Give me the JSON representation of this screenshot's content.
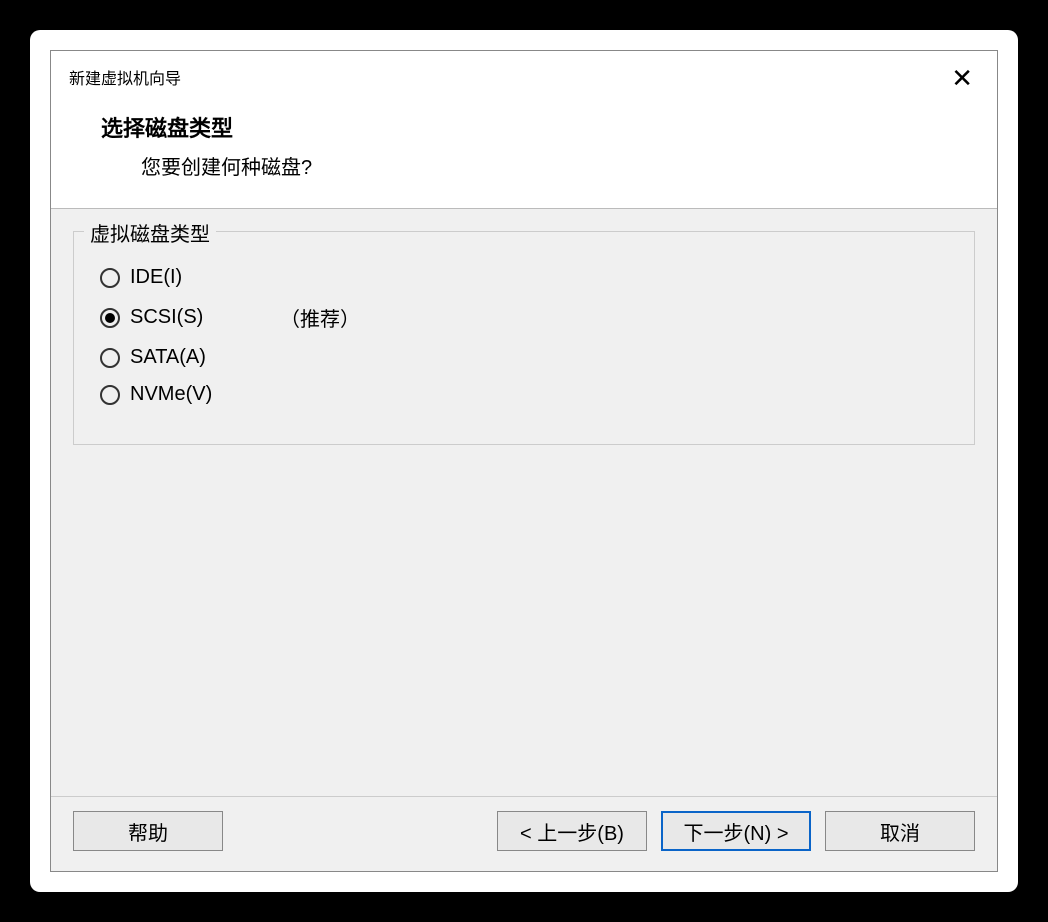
{
  "dialog": {
    "title": "新建虚拟机向导"
  },
  "header": {
    "title": "选择磁盘类型",
    "subtitle": "您要创建何种磁盘?"
  },
  "group": {
    "legend": "虚拟磁盘类型",
    "options": [
      {
        "label": "IDE(I)",
        "hint": "",
        "checked": false
      },
      {
        "label": "SCSI(S)",
        "hint": "（推荐）",
        "checked": true
      },
      {
        "label": "SATA(A)",
        "hint": "",
        "checked": false
      },
      {
        "label": "NVMe(V)",
        "hint": "",
        "checked": false
      }
    ]
  },
  "footer": {
    "help": "帮助",
    "back": "< 上一步(B)",
    "next": "下一步(N) >",
    "cancel": "取消"
  }
}
